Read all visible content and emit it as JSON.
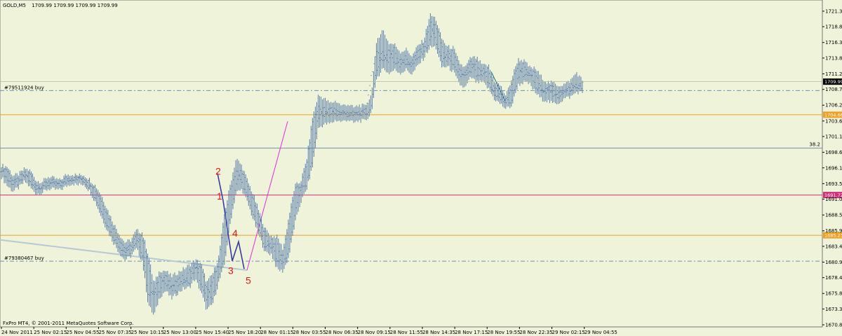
{
  "header": {
    "symbol": "GOLD,M5",
    "ohlc": "1709.99 1709.99 1709.99 1709.99"
  },
  "footer": {
    "copyright": "FxPro MT4, © 2001-2011 MetaQuotes Software Corp."
  },
  "colors": {
    "background": "#eef3da",
    "price_bars": "#5a7dab",
    "orange_level": "#f0a020",
    "magenta_level": "#d0307a",
    "steel_level": "#6f8fae",
    "fib_label": "#6f8fae",
    "trend_line": "#b8c8d4",
    "impulse_line": "#e02ce0",
    "wave_labels": "#e01818",
    "current_price_tag": "#000000"
  },
  "chart_data": {
    "type": "line",
    "chart_style": "bar (OHLC), M5 timeframe",
    "symbol": "GOLD",
    "timeframe": "M5",
    "current_price": 1709.99,
    "ylim": [
      1670.8,
      1722.7
    ],
    "y_ticks": [
      "1721.35",
      "1718.85",
      "1716.30",
      "1713.80",
      "1711.25",
      "1708.75",
      "1706.20",
      "1703.65",
      "1701.15",
      "1698.60",
      "1696.10",
      "1693.55",
      "1691.05",
      "1688.50",
      "1685.95",
      "1683.45",
      "1680.90",
      "1678.40",
      "1675.85",
      "1673.35",
      "1670.80"
    ],
    "x_ticks": [
      "24 Nov 2011",
      "25 Nov 02:15",
      "25 Nov 04:55",
      "25 Nov 07:35",
      "25 Nov 10:15",
      "25 Nov 13:00",
      "25 Nov 15:40",
      "25 Nov 18:20",
      "28 Nov 01:15",
      "28 Nov 03:55",
      "28 Nov 06:35",
      "28 Nov 09:15",
      "28 Nov 11:55",
      "28 Nov 14:35",
      "28 Nov 17:15",
      "28 Nov 19:55",
      "28 Nov 22:35",
      "29 Nov 02:15",
      "29 Nov 04:55"
    ],
    "grid": false,
    "series": [
      {
        "values": [
          [
            1695.8,
            1696.5,
            1694.6,
            1695.9
          ],
          [
            1695.9,
            1696.3,
            1693.2,
            1694.1
          ],
          [
            1694.1,
            1694.8,
            1692.3,
            1693.5
          ],
          [
            1693.5,
            1695.1,
            1692.9,
            1694.6
          ],
          [
            1694.6,
            1696.0,
            1693.9,
            1695.2
          ],
          [
            1695.2,
            1695.6,
            1692.8,
            1693.4
          ],
          [
            1693.4,
            1694.0,
            1691.9,
            1692.8
          ],
          [
            1692.8,
            1693.9,
            1692.1,
            1693.3
          ],
          [
            1693.3,
            1694.7,
            1692.7,
            1694.0
          ],
          [
            1694.0,
            1694.4,
            1692.6,
            1693.2
          ],
          [
            1693.2,
            1694.1,
            1692.5,
            1693.7
          ],
          [
            1693.7,
            1695.0,
            1693.1,
            1694.5
          ],
          [
            1694.5,
            1695.1,
            1693.6,
            1694.2
          ],
          [
            1694.2,
            1694.9,
            1693.3,
            1694.6
          ],
          [
            1694.6,
            1695.0,
            1693.5,
            1693.9
          ],
          [
            1693.9,
            1694.3,
            1692.4,
            1692.9
          ],
          [
            1692.9,
            1693.3,
            1690.6,
            1691.1
          ],
          [
            1691.1,
            1691.8,
            1688.3,
            1689.0
          ],
          [
            1689.0,
            1689.6,
            1686.1,
            1686.8
          ],
          [
            1686.8,
            1687.4,
            1684.2,
            1684.9
          ],
          [
            1684.9,
            1685.6,
            1682.6,
            1683.4
          ],
          [
            1683.4,
            1684.1,
            1681.2,
            1682.5
          ],
          [
            1682.5,
            1684.4,
            1681.8,
            1683.7
          ],
          [
            1683.7,
            1686.0,
            1683.0,
            1685.2
          ],
          [
            1685.2,
            1685.7,
            1681.1,
            1681.8
          ],
          [
            1681.8,
            1682.3,
            1674.2,
            1675.5
          ],
          [
            1675.5,
            1677.4,
            1672.2,
            1676.1
          ],
          [
            1676.1,
            1679.6,
            1675.3,
            1678.9
          ],
          [
            1678.9,
            1679.5,
            1676.3,
            1677.2
          ],
          [
            1677.2,
            1678.6,
            1675.0,
            1676.4
          ],
          [
            1676.4,
            1679.2,
            1675.9,
            1678.5
          ],
          [
            1678.5,
            1679.8,
            1676.6,
            1677.3
          ],
          [
            1677.3,
            1680.4,
            1676.8,
            1679.6
          ],
          [
            1679.6,
            1681.2,
            1678.2,
            1680.3
          ],
          [
            1680.3,
            1680.8,
            1676.1,
            1677.0
          ],
          [
            1677.0,
            1677.6,
            1673.1,
            1674.8
          ],
          [
            1674.8,
            1679.0,
            1674.1,
            1678.2
          ],
          [
            1678.2,
            1681.6,
            1677.5,
            1681.0
          ],
          [
            1681.0,
            1688.6,
            1680.4,
            1687.9
          ],
          [
            1687.9,
            1693.5,
            1687.2,
            1692.8
          ],
          [
            1692.8,
            1697.6,
            1692.1,
            1695.8
          ],
          [
            1695.8,
            1696.4,
            1692.6,
            1693.4
          ],
          [
            1693.4,
            1693.9,
            1690.3,
            1691.0
          ],
          [
            1691.0,
            1691.6,
            1687.5,
            1688.2
          ],
          [
            1688.2,
            1688.8,
            1684.9,
            1685.6
          ],
          [
            1685.6,
            1686.2,
            1682.4,
            1683.1
          ],
          [
            1683.1,
            1685.1,
            1682.2,
            1684.5
          ],
          [
            1684.5,
            1685.0,
            1679.7,
            1680.6
          ],
          [
            1680.6,
            1683.0,
            1679.4,
            1682.4
          ],
          [
            1682.4,
            1688.3,
            1681.8,
            1687.6
          ],
          [
            1687.6,
            1693.2,
            1687.0,
            1692.6
          ],
          [
            1692.6,
            1693.9,
            1690.5,
            1693.2
          ],
          [
            1693.2,
            1697.4,
            1692.6,
            1696.9
          ],
          [
            1696.9,
            1704.2,
            1696.2,
            1703.6
          ],
          [
            1703.6,
            1707.8,
            1702.5,
            1705.9
          ],
          [
            1705.9,
            1707.3,
            1703.1,
            1704.3
          ],
          [
            1704.3,
            1706.5,
            1703.2,
            1705.8
          ],
          [
            1705.8,
            1706.9,
            1703.8,
            1704.6
          ],
          [
            1704.6,
            1706.1,
            1703.5,
            1705.2
          ],
          [
            1705.2,
            1706.4,
            1703.9,
            1704.5
          ],
          [
            1704.5,
            1705.8,
            1703.3,
            1705.0
          ],
          [
            1705.0,
            1706.2,
            1703.7,
            1704.7
          ],
          [
            1704.7,
            1706.0,
            1703.6,
            1705.4
          ],
          [
            1705.4,
            1707.8,
            1704.9,
            1711.3
          ],
          [
            1711.3,
            1716.8,
            1710.6,
            1714.9
          ],
          [
            1714.9,
            1718.4,
            1712.2,
            1713.1
          ],
          [
            1713.1,
            1716.2,
            1711.3,
            1715.4
          ],
          [
            1715.4,
            1716.0,
            1711.9,
            1712.6
          ],
          [
            1712.6,
            1714.8,
            1711.4,
            1713.9
          ],
          [
            1713.9,
            1715.2,
            1711.9,
            1712.5
          ],
          [
            1712.5,
            1714.1,
            1711.2,
            1713.6
          ],
          [
            1713.6,
            1715.8,
            1712.6,
            1714.9
          ],
          [
            1714.9,
            1716.7,
            1713.8,
            1716.1
          ],
          [
            1716.1,
            1720.8,
            1715.5,
            1719.6
          ],
          [
            1719.6,
            1720.2,
            1715.6,
            1716.4
          ],
          [
            1716.4,
            1717.0,
            1712.3,
            1713.2
          ],
          [
            1713.2,
            1715.6,
            1712.4,
            1714.8
          ],
          [
            1714.8,
            1715.5,
            1711.6,
            1712.4
          ],
          [
            1712.4,
            1713.1,
            1709.6,
            1710.8
          ],
          [
            1710.8,
            1712.2,
            1708.9,
            1711.4
          ],
          [
            1711.4,
            1713.9,
            1710.7,
            1713.2
          ],
          [
            1713.2,
            1713.8,
            1709.8,
            1710.6
          ],
          [
            1710.6,
            1712.6,
            1709.9,
            1712.0
          ],
          [
            1712.0,
            1712.6,
            1708.8,
            1709.5
          ],
          [
            1709.5,
            1710.1,
            1707.2,
            1708.0
          ],
          [
            1708.0,
            1709.4,
            1706.4,
            1707.1
          ],
          [
            1707.1,
            1707.7,
            1705.6,
            1706.6
          ],
          [
            1706.6,
            1710.6,
            1706.1,
            1710.0
          ],
          [
            1710.0,
            1713.6,
            1709.4,
            1712.8
          ],
          [
            1712.8,
            1713.4,
            1709.9,
            1710.7
          ],
          [
            1710.7,
            1712.3,
            1709.6,
            1711.6
          ],
          [
            1711.6,
            1712.1,
            1708.2,
            1709.0
          ],
          [
            1709.0,
            1710.8,
            1707.2,
            1708.4
          ],
          [
            1708.4,
            1709.9,
            1706.9,
            1709.3
          ],
          [
            1709.3,
            1709.8,
            1706.4,
            1707.4
          ],
          [
            1707.4,
            1709.4,
            1706.6,
            1708.6
          ],
          [
            1708.6,
            1709.6,
            1707.3,
            1708.2
          ],
          [
            1708.2,
            1710.2,
            1707.5,
            1709.5
          ],
          [
            1709.5,
            1711.5,
            1708.3,
            1708.9
          ],
          [
            1708.9,
            1710.2,
            1708.2,
            1709.99
          ]
        ]
      }
    ]
  },
  "levels": [
    {
      "value": 1708.55,
      "style": "dashdot",
      "color": "#6f8fae",
      "label": "#79511924 buy"
    },
    {
      "value": 1704.66,
      "style": "solid",
      "color": "#f0a020",
      "tag": "1704.66"
    },
    {
      "value": 1699.27,
      "style": "solid",
      "color": "#6f8fae",
      "fib": "38.2"
    },
    {
      "value": 1691.72,
      "style": "solid",
      "color": "#d0307a",
      "tag": "1691.72"
    },
    {
      "value": 1685.23,
      "style": "solid",
      "color": "#f0a020",
      "tag": "1685.23"
    },
    {
      "value": 1681.05,
      "style": "dashdot",
      "color": "#6f8fae",
      "label": "#79380467 buy"
    }
  ],
  "wave_labels": [
    "1",
    "2",
    "3",
    "4",
    "5"
  ]
}
